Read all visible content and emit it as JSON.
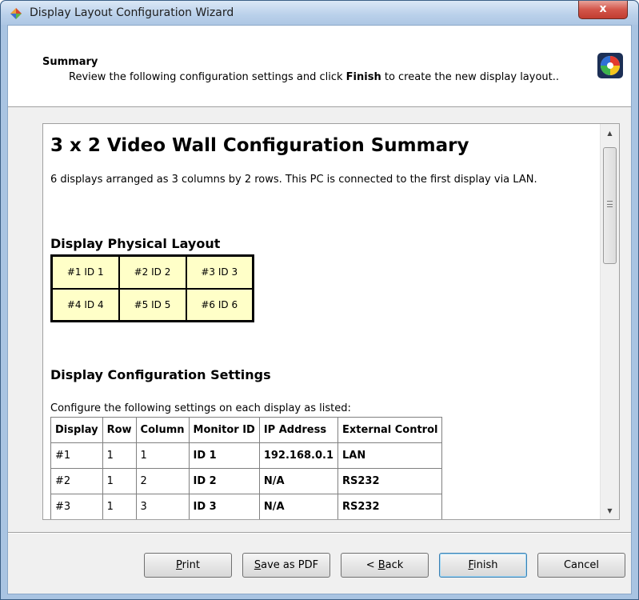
{
  "window": {
    "title": "Display Layout Configuration Wizard",
    "close_label": "x",
    "app_icon": "wizard-app-icon"
  },
  "header": {
    "title": "Summary",
    "desc_before": "Review the following configuration settings and click ",
    "desc_bold": "Finish",
    "desc_after": " to create the new display layout..",
    "logo_icon": "color-wheel-icon"
  },
  "summary": {
    "heading": "3 x 2 Video Wall Configuration Summary",
    "intro": "6 displays arranged as 3 columns by 2 rows. This PC is connected to the first display via LAN.",
    "layout_heading": "Display Physical Layout",
    "layout_cells": [
      [
        "#1 ID 1",
        "#2 ID 2",
        "#3 ID 3"
      ],
      [
        "#4 ID 4",
        "#5 ID 5",
        "#6 ID 6"
      ]
    ],
    "settings_heading": "Display Configuration Settings",
    "settings_note": "Configure the following settings on each display as listed:",
    "table": {
      "headers": [
        "Display",
        "Row",
        "Column",
        "Monitor ID",
        "IP Address",
        "External Control"
      ],
      "rows": [
        [
          "#1",
          "1",
          "1",
          "ID 1",
          "192.168.0.1",
          "LAN"
        ],
        [
          "#2",
          "1",
          "2",
          "ID 2",
          "N/A",
          "RS232"
        ],
        [
          "#3",
          "1",
          "3",
          "ID 3",
          "N/A",
          "RS232"
        ]
      ]
    }
  },
  "scrollbar": {
    "up_icon": "scroll-up-arrow-icon",
    "down_icon": "scroll-down-arrow-icon",
    "up_glyph": "▲",
    "down_glyph": "▼"
  },
  "buttons": {
    "print": {
      "prefix": "",
      "mnemonic": "P",
      "rest": "rint"
    },
    "save_pdf": {
      "prefix": "",
      "mnemonic": "S",
      "rest": "ave as PDF"
    },
    "back": {
      "prefix": "< ",
      "mnemonic": "B",
      "rest": "ack"
    },
    "finish": {
      "prefix": "",
      "mnemonic": "F",
      "rest": "inish"
    },
    "cancel": {
      "label": "Cancel"
    }
  },
  "colors": {
    "layout_cell_bg": "#ffffc8",
    "close_button": "#c13d30",
    "default_button_border": "#3c7fb1"
  }
}
